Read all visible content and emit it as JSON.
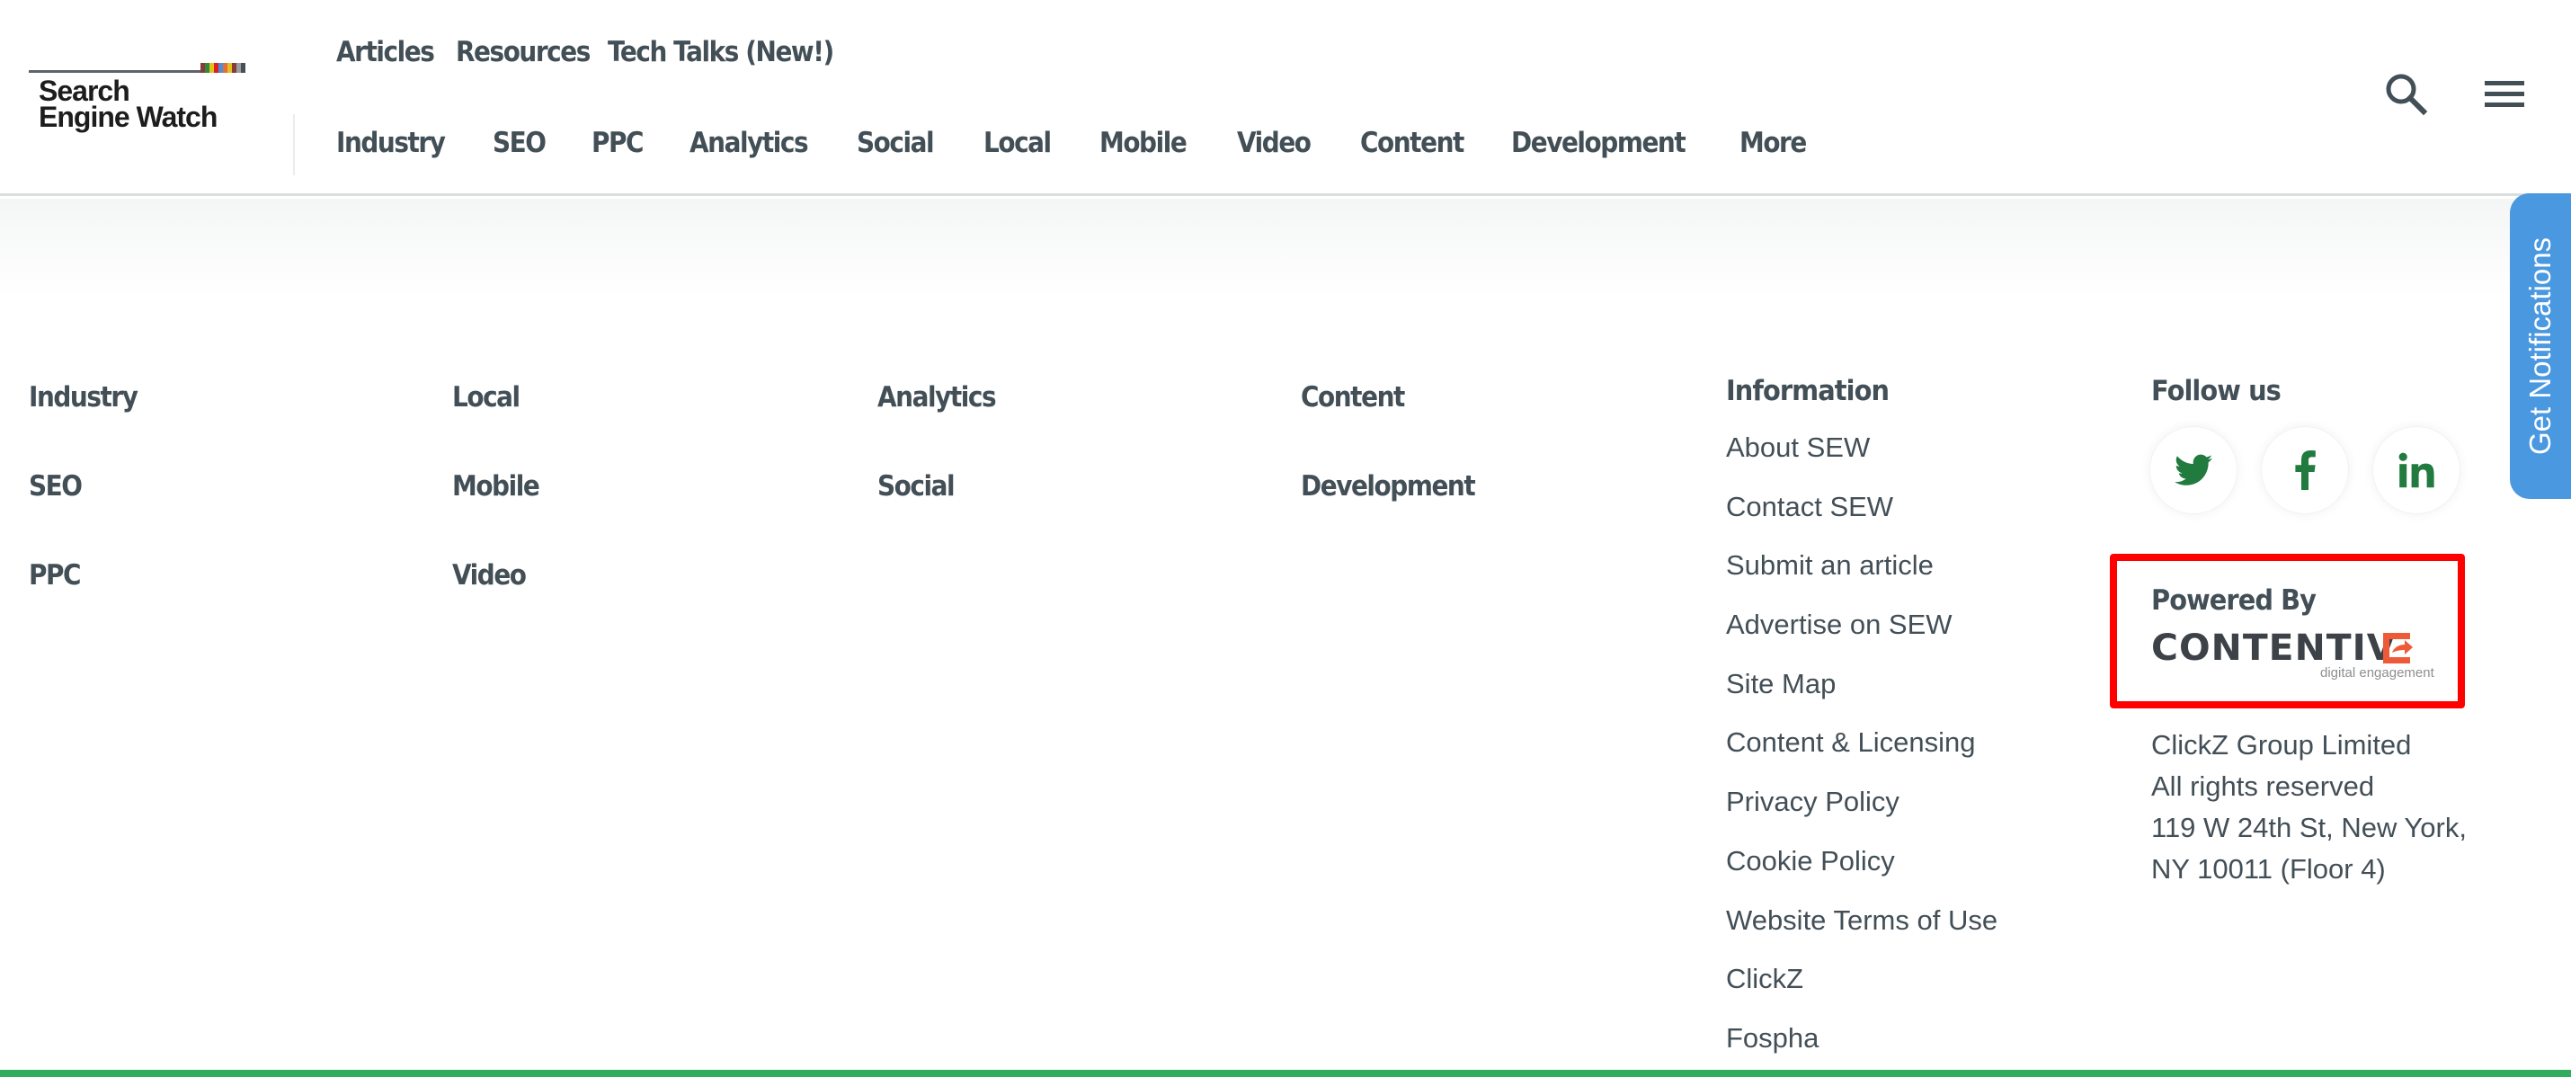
{
  "logo": {
    "text": "Search\nEngine Watch",
    "stripe_colors": [
      "#8a3a3a",
      "#2f8a3a",
      "#e0c21e",
      "#e01e1e",
      "#4a8fd6",
      "#e8693a",
      "#e0c21e",
      "#8a3a3a",
      "#9a9ea2",
      "#4a4f57"
    ]
  },
  "header": {
    "nav_top": [
      "Articles",
      "Resources",
      "Tech Talks (New!)"
    ],
    "nav_bottom": [
      "Industry",
      "SEO",
      "PPC",
      "Analytics",
      "Social",
      "Local",
      "Mobile",
      "Video",
      "Content",
      "Development",
      "More"
    ],
    "search_icon": "search-icon",
    "menu_icon": "hamburger-menu-icon",
    "notifications_label": "Get Notifications"
  },
  "footer": {
    "categories": {
      "col1": [
        "Industry",
        "SEO",
        "PPC"
      ],
      "col2": [
        "Local",
        "Mobile",
        "Video"
      ],
      "col3": [
        "Analytics",
        "Social"
      ],
      "col4": [
        "Content",
        "Development"
      ]
    },
    "information": {
      "heading": "Information",
      "links": [
        "About SEW",
        "Contact SEW",
        "Submit an article",
        "Advertise on SEW",
        "Site Map",
        "Content & Licensing",
        "Privacy Policy",
        "Cookie Policy",
        "Website Terms of Use",
        "ClickZ",
        "Fospha"
      ]
    },
    "follow": {
      "heading": "Follow us",
      "networks": [
        "twitter",
        "facebook",
        "linkedin"
      ]
    },
    "powered_by": {
      "label": "Powered By",
      "brand": "CONTENTIV",
      "tagline": "digital engagement"
    },
    "company": {
      "line1": "ClickZ Group Limited",
      "line2": "All rights reserved",
      "line3": "119 W 24th St, New York,",
      "line4": "NY 10011 (Floor 4)"
    }
  },
  "colors": {
    "text": "#434f57",
    "social_icon": "#217a3e",
    "notification_tab": "#4a98e0",
    "highlight_box": "#ff0000",
    "bottom_bar": "#32ad5e",
    "brand_accent": "#ee5a37"
  }
}
